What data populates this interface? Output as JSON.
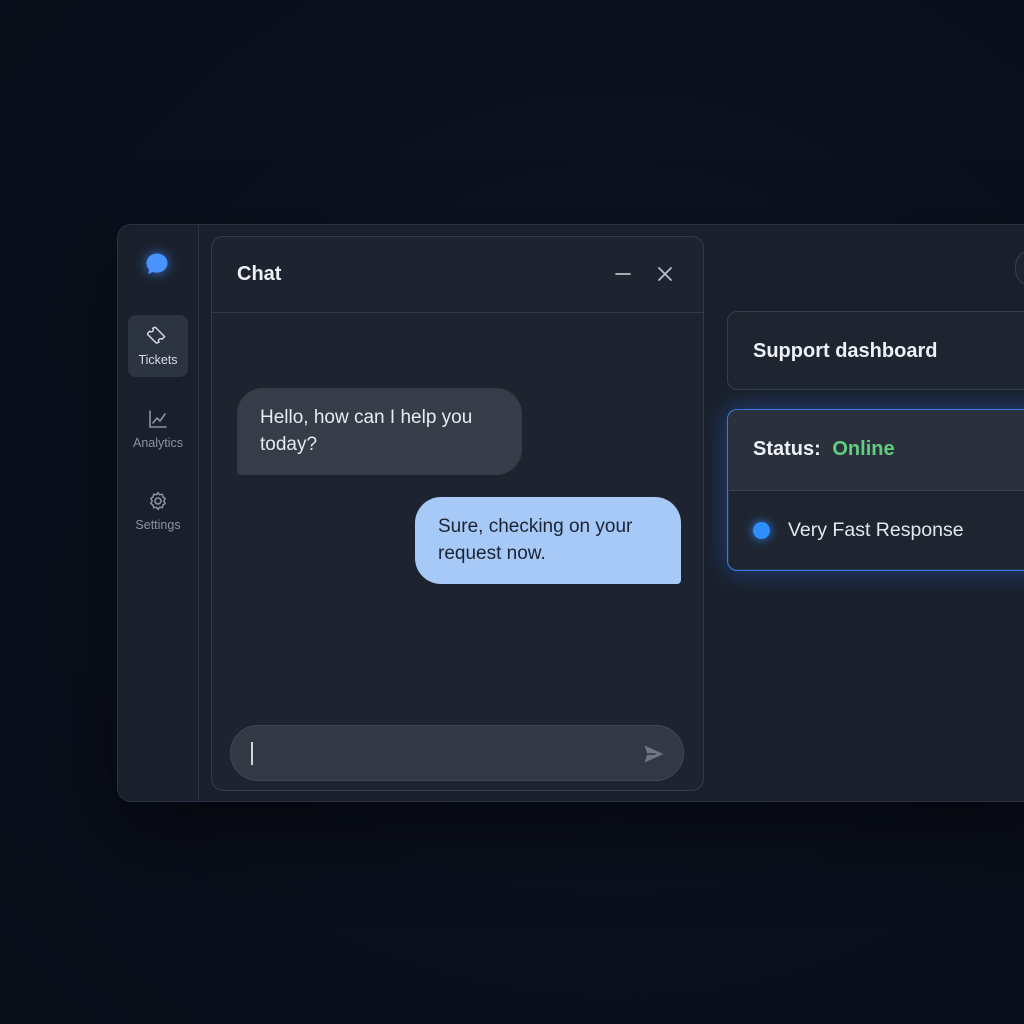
{
  "sidebar": {
    "brand_icon": "chat-bubble-icon",
    "accent": "#3b8cff",
    "items": [
      {
        "label": "Tickets",
        "icon": "ticket-icon",
        "active": true
      },
      {
        "label": "Analytics",
        "icon": "line-chart-icon",
        "active": false
      },
      {
        "label": "Settings",
        "icon": "gear-icon",
        "active": false
      }
    ]
  },
  "chat": {
    "title": "Chat",
    "minimize_icon": "minimize-icon",
    "close_icon": "close-icon",
    "messages": [
      {
        "from": "agent",
        "text": "Hello, how can I help you today?"
      },
      {
        "from": "user",
        "text": "Sure, checking on your request now."
      }
    ],
    "composer": {
      "value": "",
      "placeholder": "",
      "send_icon": "send-icon"
    }
  },
  "dashboard": {
    "title": "Support dashboard",
    "status_label": "Status:",
    "status_value": "Online",
    "status_color": "#5fce7e",
    "response_text": "Very Fast Response",
    "response_dot_color": "#2d8eff"
  }
}
